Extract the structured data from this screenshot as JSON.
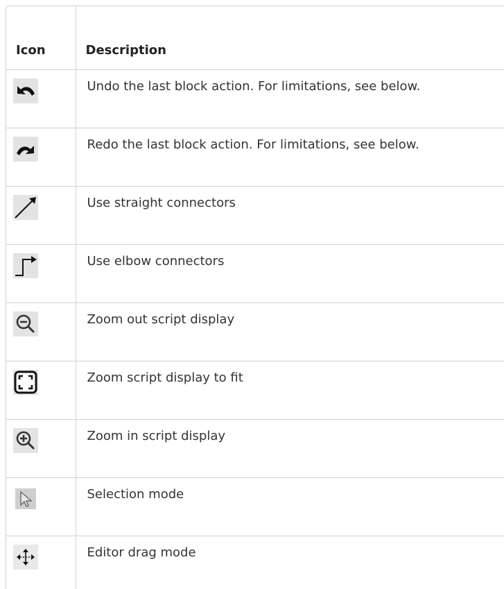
{
  "table": {
    "headers": {
      "icon": "Icon",
      "description": "Description"
    },
    "rows": [
      {
        "icon": "undo-icon",
        "description": "Undo the last block action. For limitations, see below."
      },
      {
        "icon": "redo-icon",
        "description": "Redo the last block action. For limitations, see below."
      },
      {
        "icon": "straight-connector-icon",
        "description": "Use straight connectors"
      },
      {
        "icon": "elbow-connector-icon",
        "description": "Use elbow connectors"
      },
      {
        "icon": "zoom-out-icon",
        "description": "Zoom out script display"
      },
      {
        "icon": "zoom-fit-icon",
        "description": "Zoom script display to fit"
      },
      {
        "icon": "zoom-in-icon",
        "description": "Zoom in script display"
      },
      {
        "icon": "selection-mode-icon",
        "description": "Selection mode"
      },
      {
        "icon": "drag-mode-icon",
        "description": "Editor drag mode"
      }
    ]
  },
  "colors": {
    "border": "#cfd3d7",
    "text": "#333333",
    "icon_bg": "#e3e3e3"
  }
}
